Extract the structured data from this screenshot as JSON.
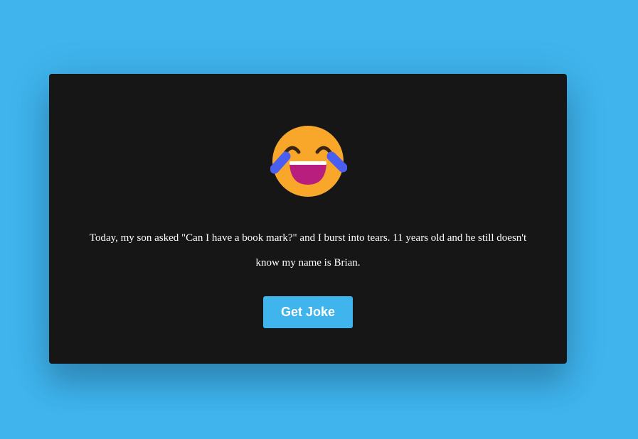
{
  "joke": {
    "text": "Today, my son asked \"Can I have a book mark?\" and I burst into tears. 11 years old and he still doesn't know my name is Brian."
  },
  "emoji": {
    "icon": "laughing-tears-emoji-icon",
    "face_color": "#f9a72b",
    "tears_color": "#4a5ff0",
    "mouth_color": "#b81e7e"
  },
  "button": {
    "label": "Get Joke",
    "color": "#3fb4ed"
  },
  "colors": {
    "background": "#3fb4ed",
    "card": "#161616",
    "text": "#ffffff"
  }
}
